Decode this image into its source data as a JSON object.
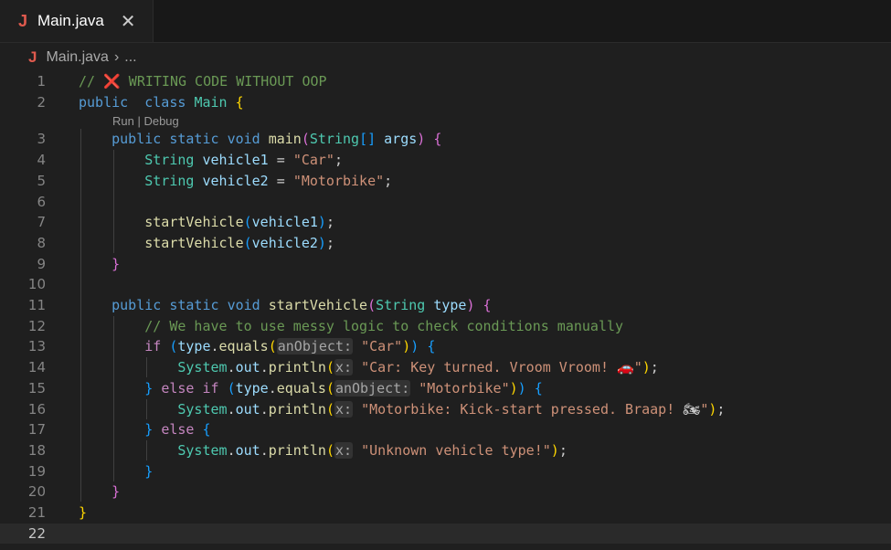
{
  "tab": {
    "icon": "J",
    "filename": "Main.java",
    "close": "✕"
  },
  "breadcrumb": {
    "icon": "J",
    "file": "Main.java",
    "separator": "›",
    "ellipsis": "..."
  },
  "codelens": "Run | Debug",
  "lines": [
    {
      "n": "1",
      "tokens": [
        [
          "cmt",
          "// "
        ],
        [
          "redx",
          "❌"
        ],
        [
          "cmt",
          " WRITING CODE WITHOUT OOP"
        ]
      ]
    },
    {
      "n": "2",
      "tokens": [
        [
          "kw",
          "public"
        ],
        [
          "",
          "  "
        ],
        [
          "kw",
          "class"
        ],
        [
          "",
          " "
        ],
        [
          "ty",
          "Main"
        ],
        [
          "",
          " "
        ],
        [
          "p1",
          "{"
        ]
      ]
    },
    {
      "n": "3",
      "tokens": [
        [
          "",
          "    "
        ],
        [
          "kw",
          "public"
        ],
        [
          "",
          " "
        ],
        [
          "kw",
          "static"
        ],
        [
          "",
          " "
        ],
        [
          "kw",
          "void"
        ],
        [
          "",
          " "
        ],
        [
          "fn",
          "main"
        ],
        [
          "p2",
          "("
        ],
        [
          "ty",
          "String"
        ],
        [
          "p3",
          "[]"
        ],
        [
          "",
          " "
        ],
        [
          "var",
          "args"
        ],
        [
          "p2",
          ")"
        ],
        [
          "",
          " "
        ],
        [
          "p2",
          "{"
        ]
      ]
    },
    {
      "n": "4",
      "tokens": [
        [
          "",
          "        "
        ],
        [
          "ty",
          "String"
        ],
        [
          "",
          " "
        ],
        [
          "var",
          "vehicle1"
        ],
        [
          "",
          " = "
        ],
        [
          "str",
          "\"Car\""
        ],
        [
          "",
          ";"
        ]
      ]
    },
    {
      "n": "5",
      "tokens": [
        [
          "",
          "        "
        ],
        [
          "ty",
          "String"
        ],
        [
          "",
          " "
        ],
        [
          "var",
          "vehicle2"
        ],
        [
          "",
          " = "
        ],
        [
          "str",
          "\"Motorbike\""
        ],
        [
          "",
          ";"
        ]
      ]
    },
    {
      "n": "6",
      "tokens": []
    },
    {
      "n": "7",
      "tokens": [
        [
          "",
          "        "
        ],
        [
          "fn",
          "startVehicle"
        ],
        [
          "p3",
          "("
        ],
        [
          "var",
          "vehicle1"
        ],
        [
          "p3",
          ")"
        ],
        [
          "",
          ";"
        ]
      ]
    },
    {
      "n": "8",
      "tokens": [
        [
          "",
          "        "
        ],
        [
          "fn",
          "startVehicle"
        ],
        [
          "p3",
          "("
        ],
        [
          "var",
          "vehicle2"
        ],
        [
          "p3",
          ")"
        ],
        [
          "",
          ";"
        ]
      ]
    },
    {
      "n": "9",
      "tokens": [
        [
          "",
          "    "
        ],
        [
          "p2",
          "}"
        ]
      ]
    },
    {
      "n": "10",
      "tokens": []
    },
    {
      "n": "11",
      "tokens": [
        [
          "",
          "    "
        ],
        [
          "kw",
          "public"
        ],
        [
          "",
          " "
        ],
        [
          "kw",
          "static"
        ],
        [
          "",
          " "
        ],
        [
          "kw",
          "void"
        ],
        [
          "",
          " "
        ],
        [
          "fn",
          "startVehicle"
        ],
        [
          "p2",
          "("
        ],
        [
          "ty",
          "String"
        ],
        [
          "",
          " "
        ],
        [
          "var",
          "type"
        ],
        [
          "p2",
          ")"
        ],
        [
          "",
          " "
        ],
        [
          "p2",
          "{"
        ]
      ]
    },
    {
      "n": "12",
      "tokens": [
        [
          "",
          "        "
        ],
        [
          "cmt",
          "// We have to use messy logic to check conditions manually"
        ]
      ]
    },
    {
      "n": "13",
      "tokens": [
        [
          "",
          "        "
        ],
        [
          "ctl",
          "if"
        ],
        [
          "",
          " "
        ],
        [
          "p3",
          "("
        ],
        [
          "var",
          "type"
        ],
        [
          "",
          "."
        ],
        [
          "fn",
          "equals"
        ],
        [
          "p1",
          "("
        ],
        [
          "hint",
          "anObject:"
        ],
        [
          "",
          " "
        ],
        [
          "str",
          "\"Car\""
        ],
        [
          "p1",
          ")"
        ],
        [
          "p3",
          ")"
        ],
        [
          "",
          " "
        ],
        [
          "p3",
          "{"
        ]
      ]
    },
    {
      "n": "14",
      "tokens": [
        [
          "",
          "            "
        ],
        [
          "ty",
          "System"
        ],
        [
          "",
          "."
        ],
        [
          "var",
          "out"
        ],
        [
          "",
          "."
        ],
        [
          "fn",
          "println"
        ],
        [
          "p1",
          "("
        ],
        [
          "hint",
          "x:"
        ],
        [
          "",
          " "
        ],
        [
          "str",
          "\"Car: Key turned. Vroom Vroom! "
        ],
        [
          "emoji",
          "🚗"
        ],
        [
          "str",
          "\""
        ],
        [
          "p1",
          ")"
        ],
        [
          "",
          ";"
        ]
      ]
    },
    {
      "n": "15",
      "tokens": [
        [
          "",
          "        "
        ],
        [
          "p3",
          "}"
        ],
        [
          "",
          " "
        ],
        [
          "ctl",
          "else"
        ],
        [
          "",
          " "
        ],
        [
          "ctl",
          "if"
        ],
        [
          "",
          " "
        ],
        [
          "p3",
          "("
        ],
        [
          "var",
          "type"
        ],
        [
          "",
          "."
        ],
        [
          "fn",
          "equals"
        ],
        [
          "p1",
          "("
        ],
        [
          "hint",
          "anObject:"
        ],
        [
          "",
          " "
        ],
        [
          "str",
          "\"Motorbike\""
        ],
        [
          "p1",
          ")"
        ],
        [
          "p3",
          ")"
        ],
        [
          "",
          " "
        ],
        [
          "p3",
          "{"
        ]
      ]
    },
    {
      "n": "16",
      "tokens": [
        [
          "",
          "            "
        ],
        [
          "ty",
          "System"
        ],
        [
          "",
          "."
        ],
        [
          "var",
          "out"
        ],
        [
          "",
          "."
        ],
        [
          "fn",
          "println"
        ],
        [
          "p1",
          "("
        ],
        [
          "hint",
          "x:"
        ],
        [
          "",
          " "
        ],
        [
          "str",
          "\"Motorbike: Kick-start pressed. Braap! "
        ],
        [
          "emoji",
          "🏍"
        ],
        [
          "str",
          "\""
        ],
        [
          "p1",
          ")"
        ],
        [
          "",
          ";"
        ]
      ]
    },
    {
      "n": "17",
      "tokens": [
        [
          "",
          "        "
        ],
        [
          "p3",
          "}"
        ],
        [
          "",
          " "
        ],
        [
          "ctl",
          "else"
        ],
        [
          "",
          " "
        ],
        [
          "p3",
          "{"
        ]
      ]
    },
    {
      "n": "18",
      "tokens": [
        [
          "",
          "            "
        ],
        [
          "ty",
          "System"
        ],
        [
          "",
          "."
        ],
        [
          "var",
          "out"
        ],
        [
          "",
          "."
        ],
        [
          "fn",
          "println"
        ],
        [
          "p1",
          "("
        ],
        [
          "hint",
          "x:"
        ],
        [
          "",
          " "
        ],
        [
          "str",
          "\"Unknown vehicle type!\""
        ],
        [
          "p1",
          ")"
        ],
        [
          "",
          ";"
        ]
      ]
    },
    {
      "n": "19",
      "tokens": [
        [
          "",
          "        "
        ],
        [
          "p3",
          "}"
        ]
      ]
    },
    {
      "n": "20",
      "tokens": [
        [
          "",
          "    "
        ],
        [
          "p2",
          "}"
        ]
      ]
    },
    {
      "n": "21",
      "tokens": [
        [
          "p1",
          "}"
        ]
      ]
    },
    {
      "n": "22",
      "tokens": []
    }
  ],
  "current_line": "22"
}
